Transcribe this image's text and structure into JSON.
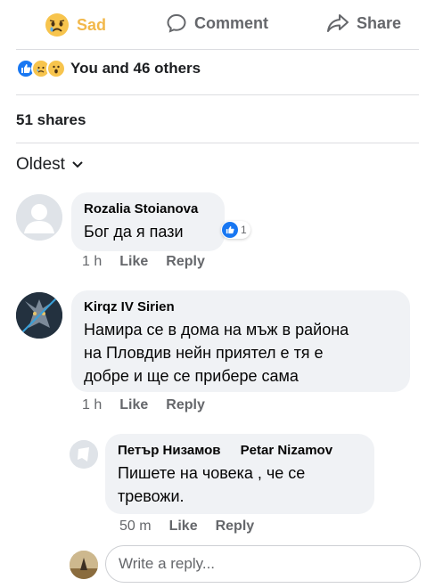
{
  "actions": {
    "sad_label": "Sad",
    "comment_label": "Comment",
    "share_label": "Share"
  },
  "reactions": {
    "summary": "You and 46 others",
    "icons": [
      "like-icon",
      "sad-icon",
      "wow-icon"
    ]
  },
  "shares": "51 shares",
  "sort": {
    "label": "Oldest"
  },
  "comments": [
    {
      "author": "Rozalia Stoianova",
      "text": "Бог да я пази",
      "time": "1 h",
      "like_label": "Like",
      "reply_label": "Reply",
      "like_count": "1"
    },
    {
      "author": "Kirqz IV Sirien",
      "text_lines": [
        "Намира се в дома на мъж в района",
        "на Пловдив нейн приятел е тя е",
        "добре и ще се прибере сама"
      ],
      "time": "1 h",
      "like_label": "Like",
      "reply_label": "Reply"
    }
  ],
  "reply": {
    "author": "Петър Низамов",
    "author_alt": "Petar Nizamov",
    "text_lines": [
      "Пишете на човека , че се",
      "тревожи."
    ],
    "time": "50 m",
    "like_label": "Like",
    "reply_label": "Reply"
  },
  "reply_input": {
    "placeholder": "Write a reply..."
  },
  "colors": {
    "sad": "#f2b84b",
    "muted": "#65676b",
    "bubble": "#f0f2f5",
    "like_blue": "#1877f2"
  }
}
